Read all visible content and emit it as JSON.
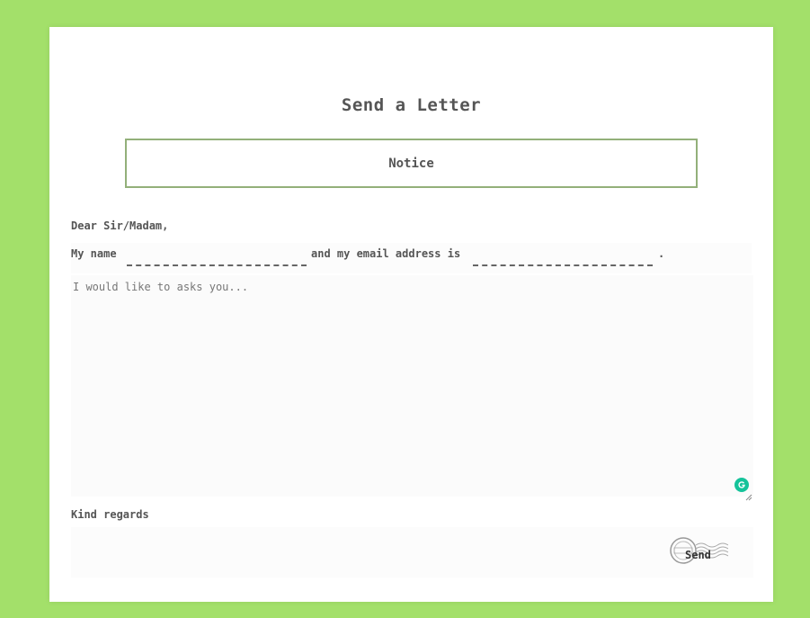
{
  "letter": {
    "title": "Send a Letter",
    "notice": "Notice",
    "salutation": "Dear Sir/Madam,",
    "name_prefix": "My name",
    "email_prefix": "and my email address is",
    "sentence_end": ".",
    "name_value": "",
    "email_value": "",
    "message_placeholder": "I would like to asks you...",
    "closing": "Kind regards",
    "send_label": "Send"
  },
  "colors": {
    "background": "#a3e06a",
    "notice_border": "#93b07a",
    "grammarly": "#15c39a"
  },
  "icons": {
    "grammarly": "grammarly-icon",
    "stamp": "postmark-stamp-icon",
    "resize": "resize-handle-icon"
  }
}
